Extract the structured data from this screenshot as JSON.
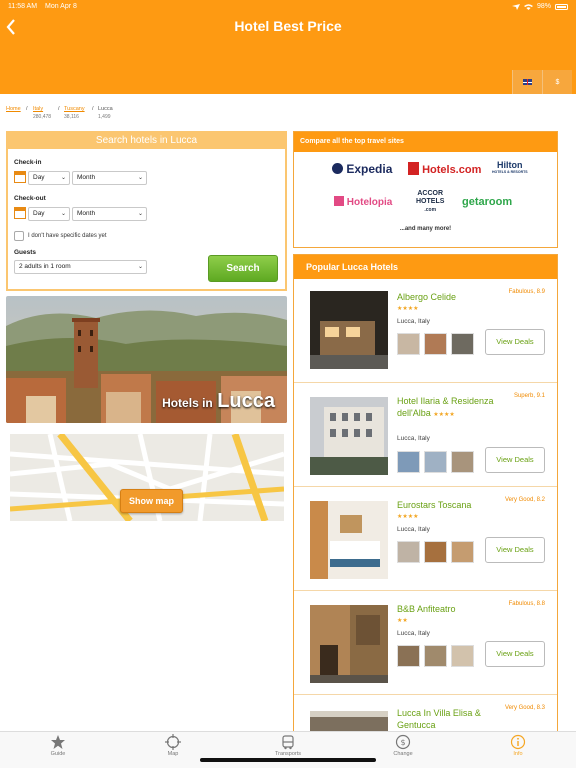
{
  "status_bar": {
    "time": "11:58 AM",
    "date": "Mon Apr 8",
    "battery": "98%"
  },
  "header": {
    "title": "Hotel Best Price",
    "language_flag": "uk-flag-icon",
    "currency": "$"
  },
  "breadcrumb": [
    {
      "label": "Home",
      "count": ""
    },
    {
      "label": "Italy",
      "count": "280,478"
    },
    {
      "label": "Tuscany",
      "count": "38,116"
    },
    {
      "label": "Lucca",
      "count": "1,499"
    }
  ],
  "search": {
    "title": "Search hotels in Lucca",
    "checkin_label": "Check-in",
    "checkout_label": "Check-out",
    "day_value": "Day",
    "month_value": "Month",
    "no_dates_label": "I don't have specific dates yet",
    "guests_label": "Guests",
    "guests_value": "2 adults in 1 room",
    "button_label": "Search"
  },
  "hero": {
    "small": "Hotels in",
    "big": "Lucca"
  },
  "map": {
    "button_label": "Show map"
  },
  "compare": {
    "title": "Compare all the top travel sites",
    "logos": {
      "expedia": "Expedia",
      "hotels": "Hotels.com",
      "hilton": "Hilton",
      "hilton_sub": "HOTELS & RESORTS",
      "hotelopia": "Hotelopia",
      "accor_1": "ACCOR",
      "accor_2": "HOTELS",
      "accor_3": ".com",
      "getaroom": "getaroom"
    },
    "more": "...and many more!"
  },
  "popular": {
    "title": "Popular Lucca Hotels",
    "hotels": [
      {
        "name": "Albergo Celide",
        "rating": "Fabulous, 8.9",
        "stars": "★★★★",
        "city": "Lucca, Italy",
        "button": "View Deals"
      },
      {
        "name": "Hotel Ilaria & Residenza dell'Alba",
        "rating": "Superb, 9.1",
        "stars": "★★★★",
        "city": "Lucca, Italy",
        "button": "View Deals"
      },
      {
        "name": "Eurostars Toscana",
        "rating": "Very Good, 8.2",
        "stars": "★★★★",
        "city": "Lucca, Italy",
        "button": "View Deals"
      },
      {
        "name": "B&B Anfiteatro",
        "rating": "Fabulous, 8.8",
        "stars": "★★",
        "city": "Lucca, Italy",
        "button": "View Deals"
      },
      {
        "name": "Lucca In Villa Elisa & Gentucca",
        "rating": "Very Good, 8.3",
        "stars": "",
        "city": "",
        "button": ""
      }
    ]
  },
  "tabs": [
    {
      "label": "Guide",
      "icon": "star-icon"
    },
    {
      "label": "Map",
      "icon": "crosshair-icon"
    },
    {
      "label": "Transports",
      "icon": "bus-icon"
    },
    {
      "label": "Change",
      "icon": "currency-exchange-icon"
    },
    {
      "label": "Info",
      "icon": "info-icon"
    }
  ],
  "colors": {
    "brand_orange": "#fe9a12",
    "green": "#6aa114",
    "active_tab": "#f5a623"
  }
}
